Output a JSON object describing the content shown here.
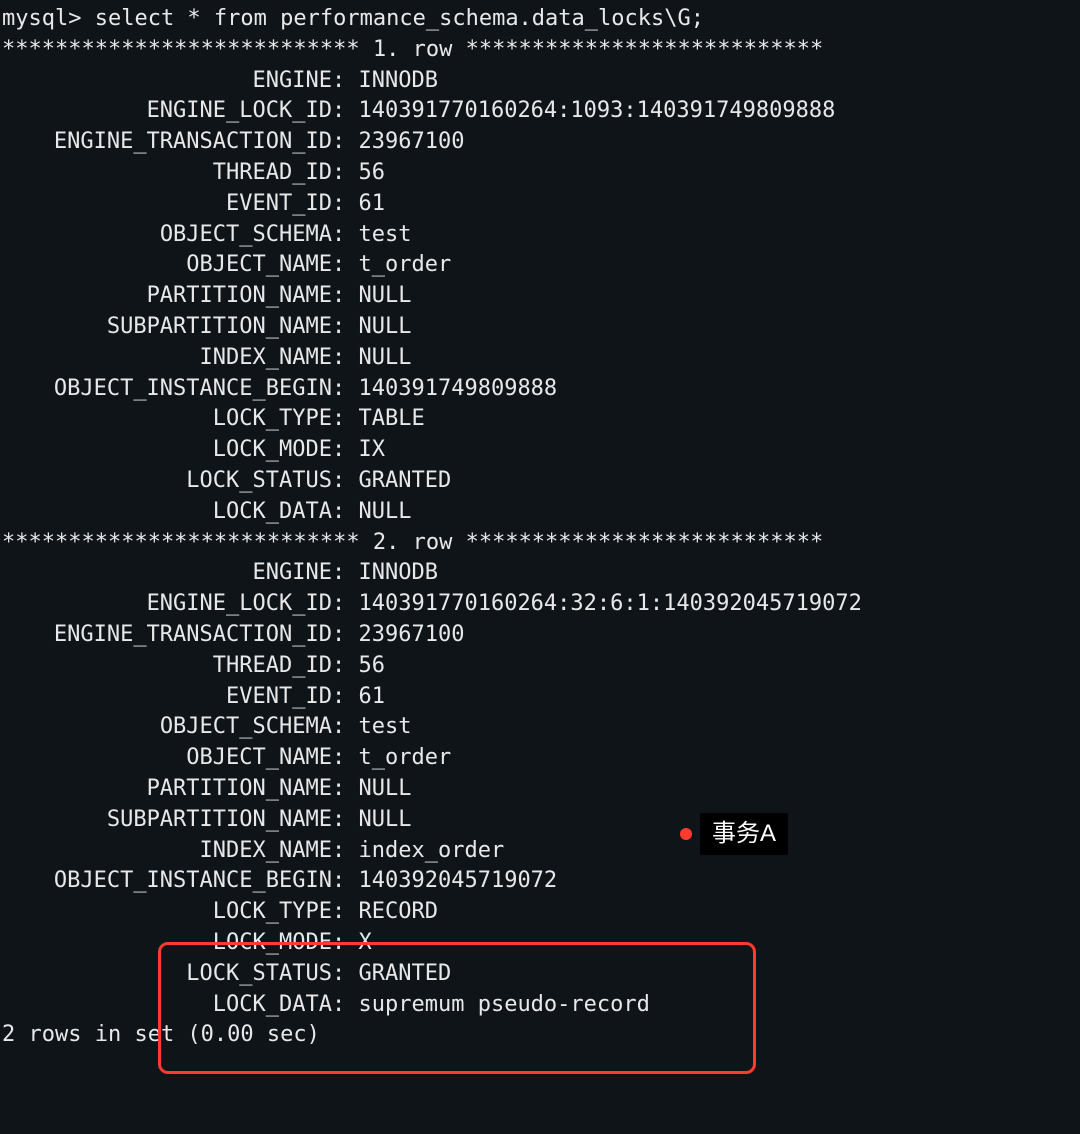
{
  "prompt": "mysql> select * from performance_schema.data_locks\\G;",
  "separator1": "*************************** 1. row ***************************",
  "separator2": "*************************** 2. row ***************************",
  "rows": [
    {
      "fields": [
        {
          "label": "ENGINE",
          "value": "INNODB"
        },
        {
          "label": "ENGINE_LOCK_ID",
          "value": "140391770160264:1093:140391749809888"
        },
        {
          "label": "ENGINE_TRANSACTION_ID",
          "value": "23967100"
        },
        {
          "label": "THREAD_ID",
          "value": "56"
        },
        {
          "label": "EVENT_ID",
          "value": "61"
        },
        {
          "label": "OBJECT_SCHEMA",
          "value": "test"
        },
        {
          "label": "OBJECT_NAME",
          "value": "t_order"
        },
        {
          "label": "PARTITION_NAME",
          "value": "NULL"
        },
        {
          "label": "SUBPARTITION_NAME",
          "value": "NULL"
        },
        {
          "label": "INDEX_NAME",
          "value": "NULL"
        },
        {
          "label": "OBJECT_INSTANCE_BEGIN",
          "value": "140391749809888"
        },
        {
          "label": "LOCK_TYPE",
          "value": "TABLE"
        },
        {
          "label": "LOCK_MODE",
          "value": "IX"
        },
        {
          "label": "LOCK_STATUS",
          "value": "GRANTED"
        },
        {
          "label": "LOCK_DATA",
          "value": "NULL"
        }
      ]
    },
    {
      "fields": [
        {
          "label": "ENGINE",
          "value": "INNODB"
        },
        {
          "label": "ENGINE_LOCK_ID",
          "value": "140391770160264:32:6:1:140392045719072"
        },
        {
          "label": "ENGINE_TRANSACTION_ID",
          "value": "23967100"
        },
        {
          "label": "THREAD_ID",
          "value": "56"
        },
        {
          "label": "EVENT_ID",
          "value": "61"
        },
        {
          "label": "OBJECT_SCHEMA",
          "value": "test"
        },
        {
          "label": "OBJECT_NAME",
          "value": "t_order"
        },
        {
          "label": "PARTITION_NAME",
          "value": "NULL"
        },
        {
          "label": "SUBPARTITION_NAME",
          "value": "NULL"
        },
        {
          "label": "INDEX_NAME",
          "value": "index_order"
        },
        {
          "label": "OBJECT_INSTANCE_BEGIN",
          "value": "140392045719072"
        },
        {
          "label": "LOCK_TYPE",
          "value": "RECORD"
        },
        {
          "label": "LOCK_MODE",
          "value": "X"
        },
        {
          "label": "LOCK_STATUS",
          "value": "GRANTED"
        },
        {
          "label": "LOCK_DATA",
          "value": "supremum pseudo-record"
        }
      ]
    }
  ],
  "footer": "2 rows in set (0.00 sec)",
  "annotation": {
    "label": "事务A"
  }
}
